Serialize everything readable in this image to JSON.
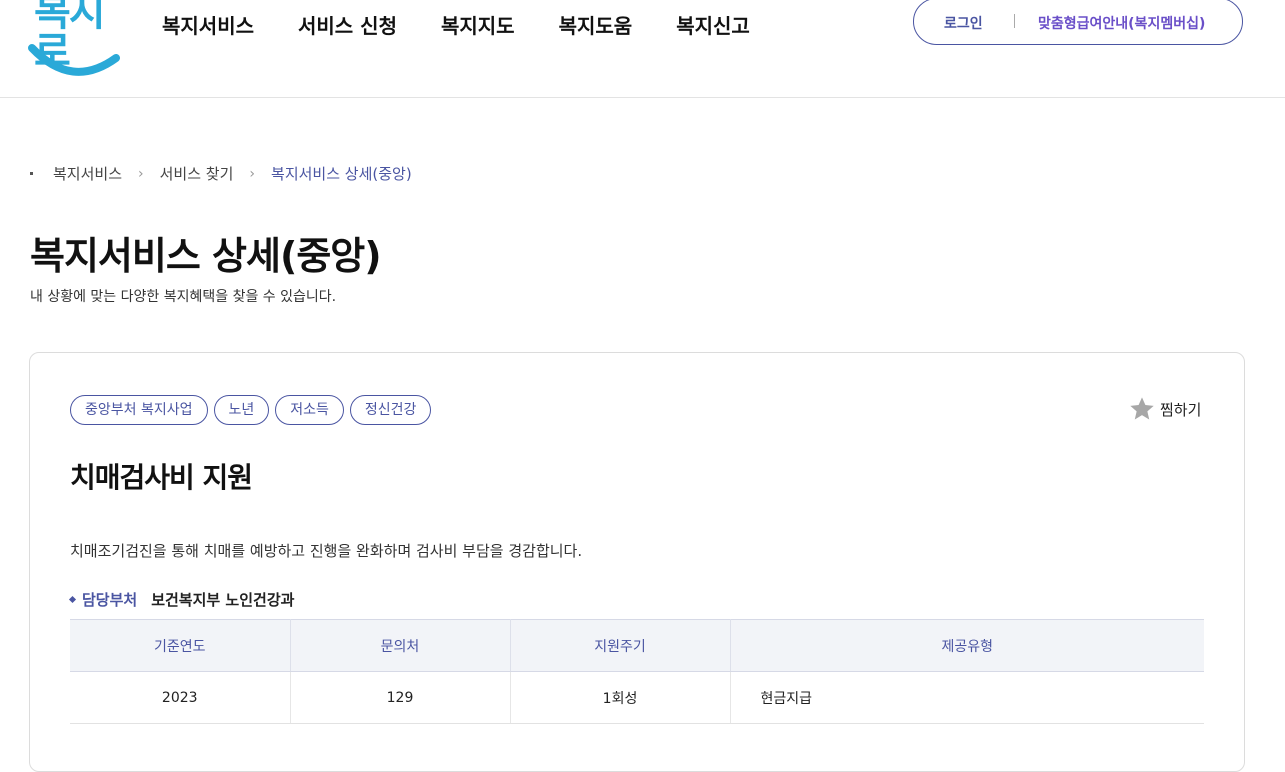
{
  "header": {
    "logo_text": "복지로",
    "nav": [
      "복지서비스",
      "서비스 신청",
      "복지지도",
      "복지도움",
      "복지신고"
    ],
    "login": "로그인",
    "membership": "맞춤형급여안내(복지멤버십)"
  },
  "breadcrumb": [
    "복지서비스",
    "서비스 찾기",
    "복지서비스 상세(중앙)"
  ],
  "page": {
    "title": "복지서비스 상세(중앙)",
    "subtitle": "내 상황에 맞는 다양한 복지혜택을 찾을 수 있습니다."
  },
  "service": {
    "tags": [
      "중앙부처 복지사업",
      "노년",
      "저소득",
      "정신건강"
    ],
    "favorite_label": "찜하기",
    "title": "치매검사비 지원",
    "description": "치매조기검진을 통해 치매를 예방하고 진행을 완화하며 검사비 부담을 경감합니다.",
    "dept_label": "담당부처",
    "dept_value": "보건복지부 노인건강과",
    "table": {
      "headers": [
        "기준연도",
        "문의처",
        "지원주기",
        "제공유형"
      ],
      "row": [
        "2023",
        "129",
        "1회성",
        "현금지급"
      ]
    }
  },
  "colors": {
    "accent": "#4a55a2",
    "logo_blue": "#2aa9d8",
    "member_purple": "#6a4fc8"
  }
}
